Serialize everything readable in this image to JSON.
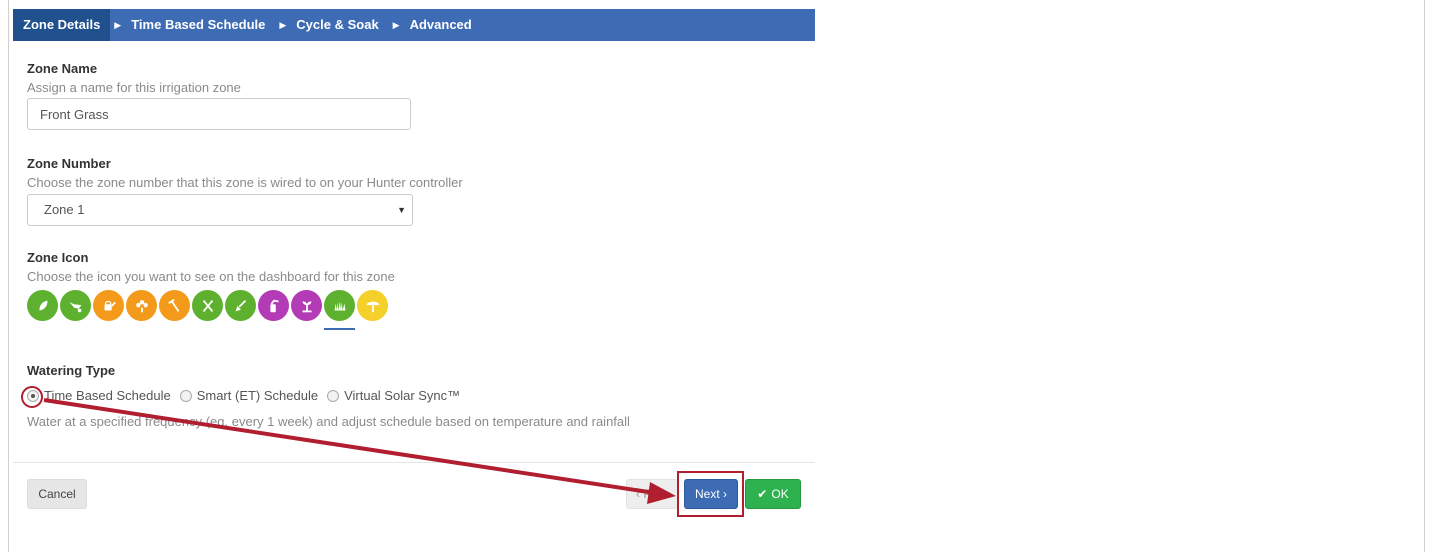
{
  "wizard": {
    "tabs": [
      {
        "label": "Zone Details"
      },
      {
        "label": "Time Based Schedule"
      },
      {
        "label": "Cycle & Soak"
      },
      {
        "label": "Advanced"
      }
    ]
  },
  "zone_name": {
    "label": "Zone Name",
    "help": "Assign a name for this irrigation zone",
    "value": "Front Grass"
  },
  "zone_number": {
    "label": "Zone Number",
    "help": "Choose the zone number that this zone is wired to on your Hunter controller",
    "selected": "Zone 1"
  },
  "zone_icon": {
    "label": "Zone Icon",
    "help": "Choose the icon you want to see on the dashboard for this zone",
    "icons": [
      {
        "name": "leaf-icon",
        "color": "#5db12e"
      },
      {
        "name": "wheelbarrow-icon",
        "color": "#5db12e"
      },
      {
        "name": "watering-can-icon",
        "color": "#f39a1b"
      },
      {
        "name": "flower-icon",
        "color": "#f39a1b"
      },
      {
        "name": "rake-icon",
        "color": "#f39a1b"
      },
      {
        "name": "shears-icon",
        "color": "#5db12e"
      },
      {
        "name": "shovel-icon",
        "color": "#5db12e"
      },
      {
        "name": "sprayer-icon",
        "color": "#b43bb6"
      },
      {
        "name": "sprout-icon",
        "color": "#b43bb6"
      },
      {
        "name": "grass-icon",
        "color": "#5db12e",
        "selected": true
      },
      {
        "name": "tree-icon",
        "color": "#f5cf2a"
      }
    ]
  },
  "watering_type": {
    "label": "Watering Type",
    "options": [
      {
        "label": "Time Based Schedule",
        "checked": true
      },
      {
        "label": "Smart (ET) Schedule",
        "checked": false
      },
      {
        "label": "Virtual Solar Sync™",
        "checked": false
      }
    ],
    "help": "Water at a specified frequency (eg. every 1 week) and adjust schedule based on temperature and rainfall"
  },
  "footer": {
    "cancel_label": "Cancel",
    "prev_label": "‹ Prev",
    "next_label": "Next ›",
    "ok_label": "OK"
  },
  "colors": {
    "accent": "#3d6cb4",
    "ok": "#2eb14f",
    "highlight": "#b11e2f"
  }
}
